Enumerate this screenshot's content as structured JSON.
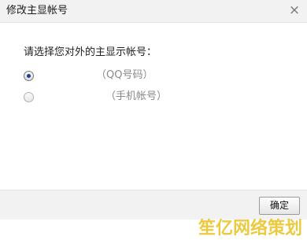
{
  "dialog": {
    "title": "修改主显帐号",
    "close_icon": "×",
    "prompt": "请选择您对外的主显示帐号：",
    "options": [
      {
        "label": "（QQ号码）",
        "selected": true
      },
      {
        "label": "（手机帐号）",
        "selected": false
      }
    ],
    "confirm_label": "确定"
  },
  "watermark": {
    "text": "笙亿网络策划"
  },
  "colors": {
    "titlebar_bg": "#f2f2f2",
    "footer_bg": "#f2f2f2",
    "watermark": "#e6b900",
    "radio_dot": "#1b3e8c"
  }
}
